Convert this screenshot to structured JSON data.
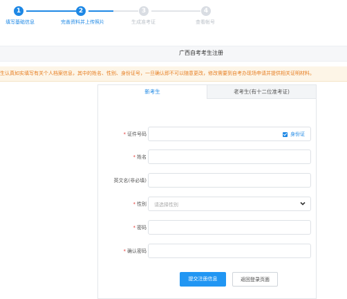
{
  "steps": [
    {
      "number": "1",
      "label": "填写基础信息",
      "state": "active"
    },
    {
      "number": "2",
      "label": "完善资料并上传照片",
      "state": "active"
    },
    {
      "number": "3",
      "label": "生成准考证",
      "state": "inactive"
    },
    {
      "number": "4",
      "label": "查看帐号",
      "state": "inactive"
    }
  ],
  "page_title": "广西自考考生注册",
  "notice": "生认真如实填写有关个人档案信息，其中的姓名、性别、身份证号，一旦确认即不可以随意更改，修改需要到自考办现场申请并提供相关证明材料。",
  "tabs": {
    "new": "新考生",
    "old": "老考生(有十二位准考证)"
  },
  "form": {
    "id_label": "证件号码",
    "id_type": "身份证",
    "name_label": "姓名",
    "english_label": "英文名(非必填)",
    "gender_label": "性别",
    "gender_placeholder": "请选择性别",
    "password_label": "密码",
    "confirm_label": "确认密码",
    "submit": "提交注册信息",
    "back": "返回登录页面"
  },
  "colors": {
    "accent": "#1e88e5",
    "required": "#e53935",
    "notice": "#e67e22"
  }
}
